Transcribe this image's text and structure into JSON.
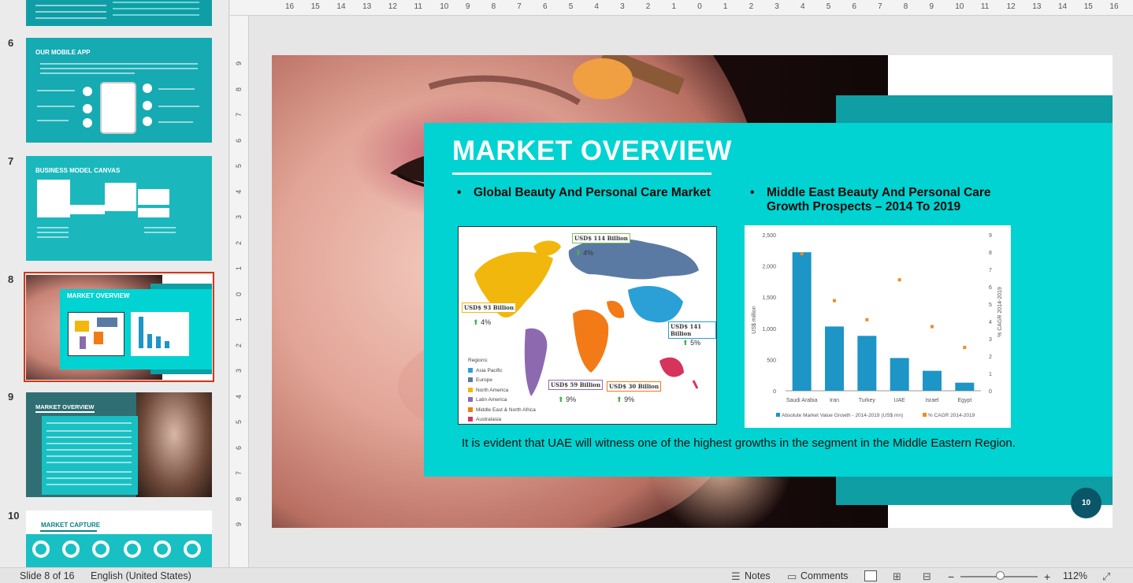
{
  "thumbnails": [
    {
      "number": "",
      "title": ""
    },
    {
      "number": "6",
      "title": "OUR MOBILE APP"
    },
    {
      "number": "7",
      "title": "BUSINESS MODEL CANVAS"
    },
    {
      "number": "8",
      "title": "MARKET OVERVIEW",
      "selected": true
    },
    {
      "number": "9",
      "title": "MARKET OVERVIEW"
    },
    {
      "number": "10",
      "title": "MARKET CAPTURE"
    }
  ],
  "slide": {
    "title": "MARKET OVERVIEW",
    "bullet1": "Global Beauty And Personal Care Market",
    "bullet2_line1": "Middle East Beauty And Personal Care",
    "bullet2_line2": "Growth Prospects – 2014 To 2019",
    "bullet_symbol": "•",
    "map": {
      "labels": [
        {
          "name": "na",
          "value": "USD$ 93 Billion",
          "growth": "4%"
        },
        {
          "name": "eu",
          "value": "USD$ 114 Billion",
          "growth": "4%"
        },
        {
          "name": "ap",
          "value": "USD$ 141 Billion",
          "growth": "5%"
        },
        {
          "name": "la",
          "value": "USD$ 59 Billion",
          "growth": "9%"
        },
        {
          "name": "me",
          "value": "USD$ 30 Billion",
          "growth": "9%"
        }
      ],
      "legend_title": "Regions:",
      "legend": [
        {
          "label": "Asia Pacific",
          "color": "#2aa0d6"
        },
        {
          "label": "Europe",
          "color": "#5b7aa3"
        },
        {
          "label": "North America",
          "color": "#f2b70c"
        },
        {
          "label": "Latin America",
          "color": "#8d6ab0"
        },
        {
          "label": "Middle East & North Africa",
          "color": "#f27a17"
        },
        {
          "label": "Australasia",
          "color": "#d6335d"
        }
      ]
    },
    "conclusion": "It is evident that UAE will witness one of the highest growths in the segment in the Middle Eastern Region.",
    "page_number": "10"
  },
  "chart_data": {
    "type": "bar",
    "categories": [
      "Saudi Arabia",
      "Iran",
      "Turkey",
      "UAE",
      "Israel",
      "Egypt"
    ],
    "series": [
      {
        "name": "Absolute Market Value Growth - 2014-2019 (US$ mn)",
        "values": [
          2220,
          1030,
          880,
          525,
          320,
          130
        ],
        "color": "#1d95c6",
        "axis": "left"
      },
      {
        "name": "% CAGR 2014-2019",
        "values": [
          7.9,
          5.2,
          4.1,
          6.4,
          3.7,
          2.5
        ],
        "color": "#f28a1e",
        "axis": "right",
        "marker": "square"
      }
    ],
    "ylabel": "US$ million",
    "y2label": "% CAGR 2014-2019",
    "ylim": [
      0,
      2500
    ],
    "y2lim": [
      0,
      9
    ],
    "yticks": [
      "0",
      "500",
      "1,000",
      "1,500",
      "2,000",
      "2,500"
    ],
    "y2ticks": [
      "0",
      "1",
      "2",
      "3",
      "4",
      "5",
      "6",
      "7",
      "8",
      "9"
    ],
    "grid": false,
    "legend_position": "bottom"
  },
  "ruler": {
    "h_ticks": [
      "16",
      "15",
      "14",
      "13",
      "12",
      "11",
      "10",
      "9",
      "8",
      "7",
      "6",
      "5",
      "4",
      "3",
      "2",
      "1",
      "0",
      "1",
      "2",
      "3",
      "4",
      "5",
      "6",
      "7",
      "8",
      "9",
      "10",
      "11",
      "12",
      "13",
      "14",
      "15",
      "16"
    ],
    "v_ticks": [
      "9",
      "8",
      "7",
      "6",
      "5",
      "4",
      "3",
      "2",
      "1",
      "0",
      "1",
      "2",
      "3",
      "4",
      "5",
      "6",
      "7",
      "8",
      "9"
    ]
  },
  "status": {
    "slide_info": "Slide 8 of 16",
    "language": "English (United States)",
    "notes": "Notes",
    "comments": "Comments",
    "zoom": "112%",
    "zoom_minus": "−",
    "zoom_plus": "+"
  }
}
